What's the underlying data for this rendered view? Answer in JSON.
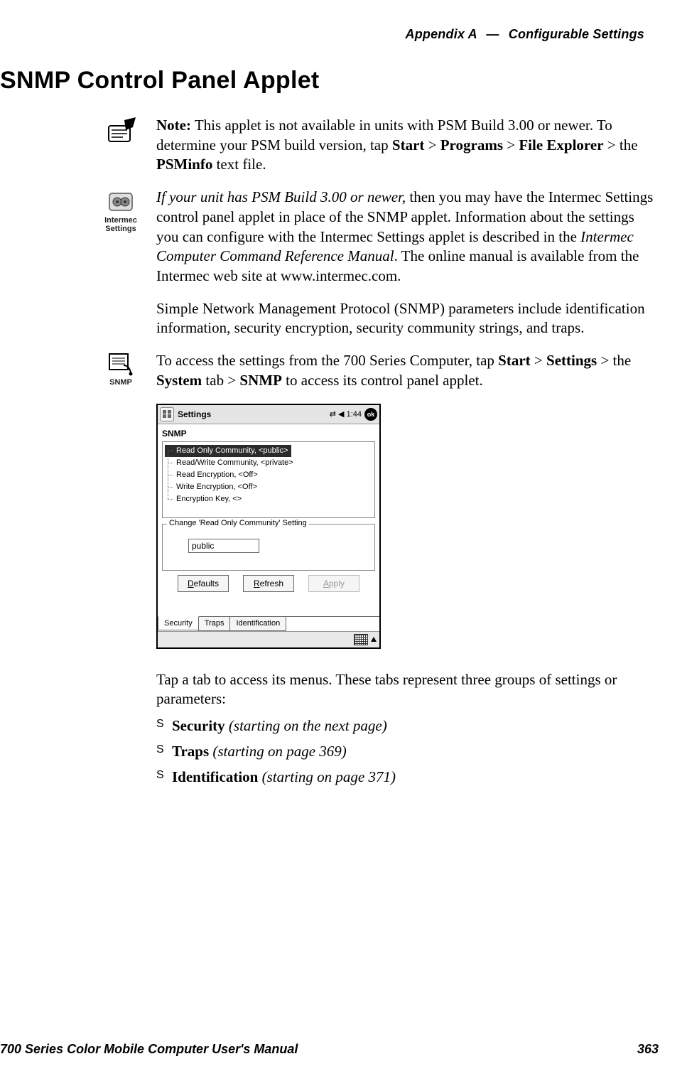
{
  "header": {
    "appendix": "Appendix A",
    "dash": "—",
    "title": "Configurable Settings"
  },
  "section_title": "SNMP Control Panel Applet",
  "note_block": {
    "prefix": "Note:",
    "text_1": " This applet is not available in units with PSM Build 3.00 or newer. To determine your PSM build version, tap ",
    "start": "Start",
    "gt1": " > ",
    "programs": "Programs",
    "gt2": " > ",
    "file_explorer": "File Explorer",
    "gt3": " > the ",
    "psminfo": "PSMinfo",
    "tail": " text file."
  },
  "intermec_block": {
    "icon_caption": "Intermec Settings",
    "lead_em": "If your unit has PSM Build 3.00 or newer,",
    "text_1": " then you may have the Intermec Settings control panel applet in place of the SNMP applet. Information about the settings you can configure with the Intermec Settings applet is described in the ",
    "manual_em": "Intermec Computer Command Reference Manual",
    "text_2": ". The online manual is available from the Intermec web site at www.intermec.com."
  },
  "para_snmp": "Simple Network Management Protocol (SNMP) parameters include identification information, security encryption, security community strings, and traps.",
  "snmp_icon_caption": "SNMP",
  "access_block": {
    "t1": "To access the settings from the 700 Series Computer, tap ",
    "start": "Start",
    "gt1": " > ",
    "settings": "Settings",
    "gt2": " > the ",
    "system": "System",
    "t2": " tab > ",
    "snmp": "SNMP",
    "t3": " to access its control panel applet."
  },
  "screenshot": {
    "titlebar": {
      "title": "Settings",
      "time": "1:44",
      "ok": "ok"
    },
    "panel_title": "SNMP",
    "tree": [
      "Read Only Community, <public>",
      "Read/Write Community, <private>",
      "Read Encryption, <Off>",
      "Write Encryption, <Off>",
      "Encryption Key, <>"
    ],
    "fieldset_legend": "Change 'Read Only Community' Setting",
    "fieldset_value": "public",
    "buttons": {
      "defaults": "Defaults",
      "refresh": "Refresh",
      "apply": "Apply"
    },
    "tabs": [
      "Security",
      "Traps",
      "Identification"
    ]
  },
  "after_shot": "Tap a tab to access its menus. These tabs represent three groups of settings or parameters:",
  "bullets": [
    {
      "bold": "Security",
      "em": " (starting on the next page)"
    },
    {
      "bold": "Traps",
      "em": " (starting on page 369)"
    },
    {
      "bold": "Identification",
      "em": " (starting on page 371)"
    }
  ],
  "footer": {
    "left": "700 Series Color Mobile Computer User's Manual",
    "right": "363"
  }
}
